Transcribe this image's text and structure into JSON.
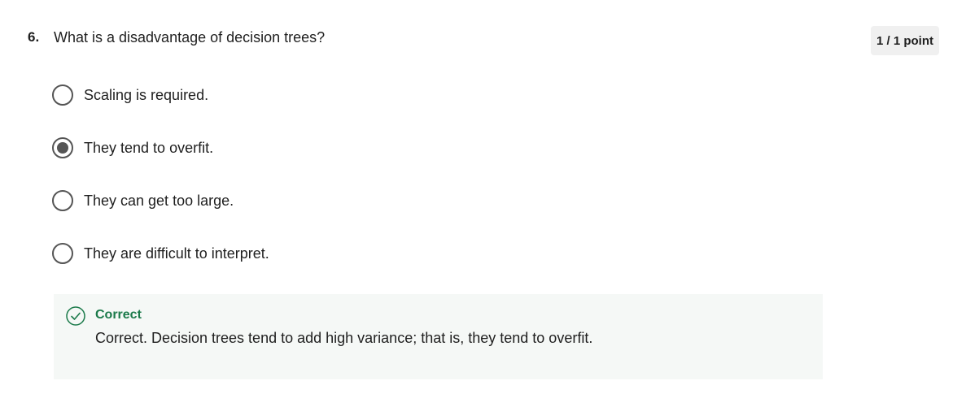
{
  "question": {
    "number": "6.",
    "text": "What is a disadvantage of decision trees?",
    "points": "1 / 1 point"
  },
  "options": [
    {
      "label": "Scaling is required.",
      "selected": false
    },
    {
      "label": "They tend to overfit.",
      "selected": true
    },
    {
      "label": "They can get too large.",
      "selected": false
    },
    {
      "label": "They are difficult to interpret.",
      "selected": false
    }
  ],
  "feedback": {
    "status": "Correct",
    "explanation": "Correct. Decision trees tend to add high variance; that is, they tend to overfit.",
    "status_icon": "check-circle-icon"
  },
  "colors": {
    "correct_green": "#1b7a4a",
    "feedback_bg": "#f5f8f6",
    "radio_gray": "#555555",
    "badge_bg": "#f0f0f0"
  }
}
